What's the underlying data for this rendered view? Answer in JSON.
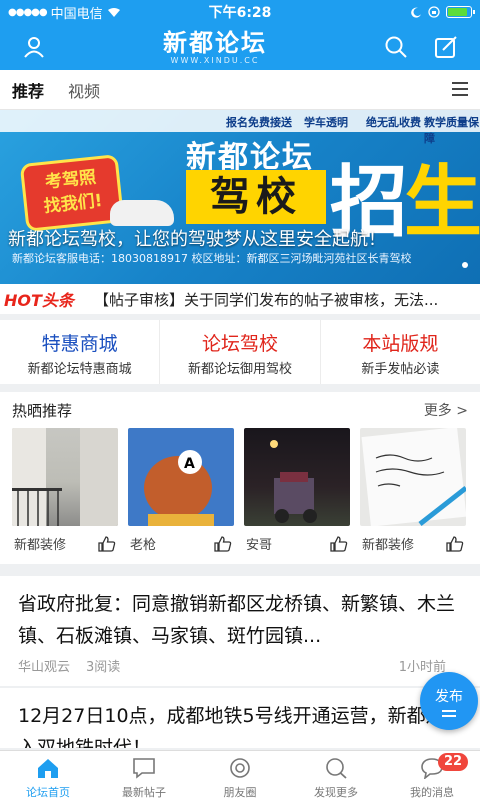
{
  "status_bar": {
    "carrier": "中国电信",
    "time": "下午6:28",
    "battery_level": 0.8
  },
  "header": {
    "logo_title": "新都论坛",
    "logo_sub": "WWW.XINDU.CC",
    "icons": [
      "user-icon",
      "search-icon",
      "edit-icon"
    ]
  },
  "tabs": [
    {
      "label": "推荐",
      "active": true
    },
    {
      "label": "视频",
      "active": false
    }
  ],
  "banner": {
    "strip_items": [
      "报名免费接送",
      "学车透明",
      "绝无乱收费",
      "教学质量保障"
    ],
    "badge_text_1": "考驾照",
    "badge_text_2": "找我们!",
    "title_big": "新都论坛",
    "jiaxiao": "驾校",
    "zhao": "招",
    "sheng": "生",
    "info_line": "新都论坛客服电话：18030818917   校区地址：新都区三河场毗河苑社区长青驾校",
    "caption": "新都论坛驾校，让您的驾驶梦从这里安全起航！"
  },
  "headline": {
    "logo": "HOT头条",
    "text": "【帖子审核】关于同学们发布的帖子被审核，无法..."
  },
  "quick_links": [
    {
      "title": "特惠商城",
      "sub": "新都论坛特惠商城",
      "color": "#1a4fbf"
    },
    {
      "title": "论坛驾校",
      "sub": "新都论坛御用驾校",
      "color": "#e0251b"
    },
    {
      "title": "本站版规",
      "sub": "新手发帖必读",
      "color": "#e0251b"
    }
  ],
  "hot_section": {
    "title": "热晒推荐",
    "more": "更多 >",
    "cards": [
      {
        "author": "新都装修"
      },
      {
        "author": "老枪"
      },
      {
        "author": "安哥"
      },
      {
        "author": "新都装修"
      }
    ]
  },
  "posts": [
    {
      "title": "省政府批复：同意撤销新都区龙桥镇、新繁镇、木兰镇、石板滩镇、马家镇、斑竹园镇...",
      "author": "华山观云",
      "reads": "3阅读",
      "time": "1小时前"
    },
    {
      "title": "12月27日10点，成都地铁5号线开通运营，新都进入双地铁时代！"
    }
  ],
  "fab": {
    "label": "发布"
  },
  "bottom_nav": [
    {
      "label": "论坛首页",
      "icon": "home-icon",
      "active": true
    },
    {
      "label": "最新帖子",
      "icon": "chat-icon",
      "active": false
    },
    {
      "label": "朋友圈",
      "icon": "camera-icon",
      "active": false
    },
    {
      "label": "发现更多",
      "icon": "discover-icon",
      "active": false
    },
    {
      "label": "我的消息",
      "icon": "message-icon",
      "active": false,
      "badge": "22"
    }
  ],
  "colors": {
    "brand": "#1e9ef0",
    "red": "#e0251b",
    "blue": "#1a4fbf"
  }
}
